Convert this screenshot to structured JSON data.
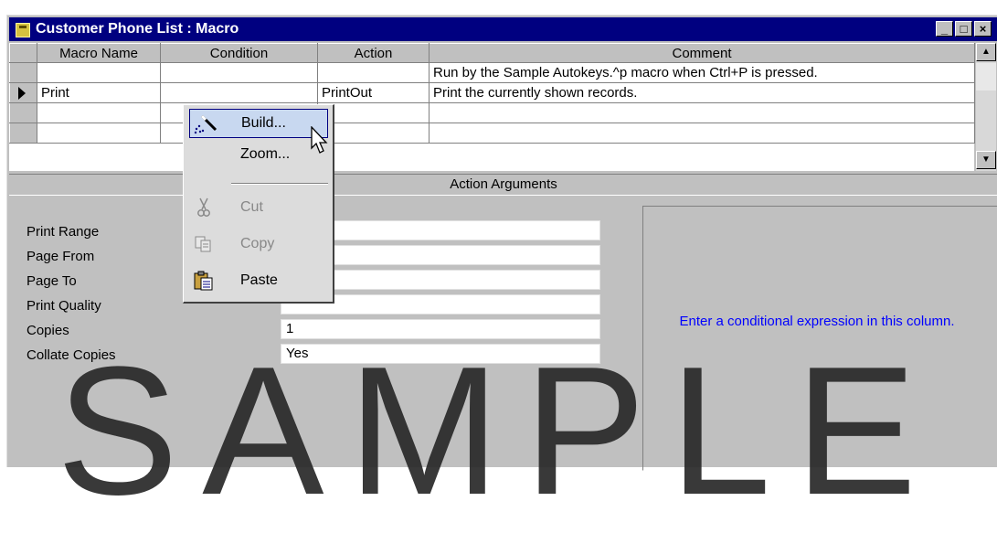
{
  "window": {
    "title": "Customer Phone List : Macro",
    "controls": [
      "_",
      "□",
      "×"
    ]
  },
  "grid": {
    "columns": [
      "Macro Name",
      "Condition",
      "Action",
      "Comment"
    ],
    "rows": [
      {
        "macro_name": "",
        "condition": "",
        "action": "",
        "comment": "Run by the Sample Autokeys.^p macro when Ctrl+P is pressed."
      },
      {
        "macro_name": "Print",
        "condition": "",
        "action": "PrintOut",
        "comment": "Print the currently shown records.",
        "current": true
      },
      {
        "macro_name": "",
        "condition": "",
        "action": "",
        "comment": ""
      },
      {
        "macro_name": "",
        "condition": "",
        "action": "",
        "comment": ""
      }
    ]
  },
  "action_arguments": {
    "header": "Action Arguments",
    "fields": [
      {
        "label": "Print Range",
        "value": ""
      },
      {
        "label": "Page From",
        "value": ""
      },
      {
        "label": "Page To",
        "value": ""
      },
      {
        "label": "Print Quality",
        "value": ""
      },
      {
        "label": "Copies",
        "value": "1"
      },
      {
        "label": "Collate Copies",
        "value": "Yes"
      }
    ],
    "hint": "Enter a conditional expression in this column."
  },
  "context_menu": {
    "items": [
      {
        "label": "Build...",
        "icon": "build-wand-icon",
        "highlighted": true,
        "enabled": true
      },
      {
        "label": "Zoom...",
        "icon": "",
        "enabled": true
      },
      {
        "label": "Cut",
        "icon": "scissors-icon",
        "enabled": false
      },
      {
        "label": "Copy",
        "icon": "copy-icon",
        "enabled": false
      },
      {
        "label": "Paste",
        "icon": "paste-clipboard-icon",
        "enabled": true
      }
    ]
  },
  "watermark": "SAMPLE",
  "colors": {
    "title_bar": "#000080",
    "hint_text": "#0000ff",
    "window_face": "#c0c0c0"
  }
}
